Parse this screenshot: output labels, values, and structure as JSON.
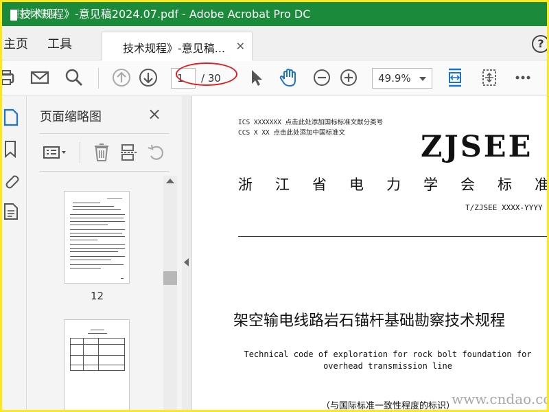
{
  "window": {
    "title": "技术规程》-意见稿2024.07.pdf - Adobe Acrobat Pro DC",
    "title_watermark": "技术规程"
  },
  "tabs": {
    "home": "主页",
    "tools": "工具",
    "document": "技术规程》-意见稿...",
    "close": "×",
    "help": "?"
  },
  "toolbar": {
    "current_page": "1",
    "page_total": "/ 30",
    "zoom": "49.9%"
  },
  "thumbnails_panel": {
    "title": "页面缩略图",
    "close": "×",
    "page_label": "12"
  },
  "document": {
    "ics_line": "ICS XXXXXXX 点击此处添加国标标准文献分类号",
    "ccs_line": "CCS X XX 点击此处添加中国标准文",
    "org_logo_text": "ZJSEE",
    "association": "浙江省电力学会标准",
    "standard_code": "T/ZJSEE XXXX-YYYY",
    "title_cn": "架空输电线路岩石锚杆基础勘察技术规程",
    "title_en": "Technical code of exploration for rock bolt foundation for  overhead transmission line",
    "consistency_note": "（与国际标准一致性程度的标识）"
  },
  "watermark": "www.cndao.com",
  "colors": {
    "titlebar": "#1b8a3a",
    "accent_blue": "#1a73c8",
    "highlight_frame": "#ffe81a",
    "annotation_circle": "#e02020"
  }
}
